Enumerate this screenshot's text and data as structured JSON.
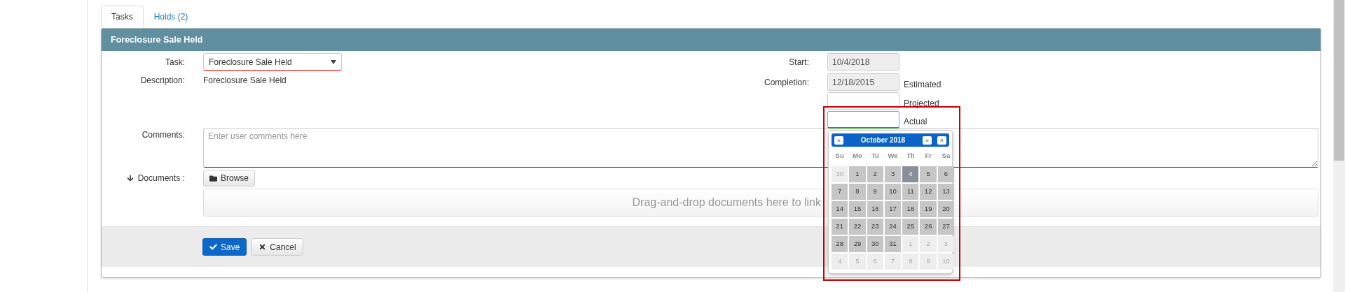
{
  "tabs": [
    {
      "label": "Tasks",
      "selected": true
    },
    {
      "label": "Holds (2)",
      "selected": false
    }
  ],
  "panel": {
    "title": "Foreclosure Sale Held",
    "task": {
      "label": "Task:",
      "value": "Foreclosure Sale Held"
    },
    "description": {
      "label": "Description:",
      "value": "Foreclosure Sale Held"
    },
    "start": {
      "label": "Start:",
      "value": "10/4/2018"
    },
    "completion": {
      "label": "Completion:",
      "value": "12/18/2015",
      "suffix": "Estimated"
    },
    "projected": {
      "suffix": "Projected"
    },
    "actual": {
      "suffix": "Actual"
    },
    "comments": {
      "label": "Comments:",
      "placeholder": "Enter user comments here"
    },
    "documents": {
      "label": "Documents :",
      "browse": "Browse",
      "dropzone": "Drag-and-drop documents here to link"
    },
    "buttons": [
      {
        "label": "Save",
        "kind": "primary"
      },
      {
        "label": "Cancel",
        "kind": "default"
      }
    ]
  },
  "datepicker": {
    "prev": "«",
    "title": "October 2018",
    "next": "»",
    "close": "×",
    "weekdays": [
      "Su",
      "Mo",
      "Tu",
      "We",
      "Th",
      "Fr",
      "Sa"
    ],
    "weeks": [
      [
        {
          "day": "30",
          "kind": "other",
          "selected": false
        },
        {
          "day": "1",
          "kind": "current",
          "selected": false
        },
        {
          "day": "2",
          "kind": "current",
          "selected": false
        },
        {
          "day": "3",
          "kind": "current",
          "selected": false
        },
        {
          "day": "4",
          "kind": "current",
          "selected": true
        },
        {
          "day": "5",
          "kind": "current",
          "selected": false
        },
        {
          "day": "6",
          "kind": "current",
          "selected": false
        }
      ],
      [
        {
          "day": "7",
          "kind": "current",
          "selected": false
        },
        {
          "day": "8",
          "kind": "current",
          "selected": false
        },
        {
          "day": "9",
          "kind": "current",
          "selected": false
        },
        {
          "day": "10",
          "kind": "current",
          "selected": false
        },
        {
          "day": "11",
          "kind": "current",
          "selected": false
        },
        {
          "day": "12",
          "kind": "current",
          "selected": false
        },
        {
          "day": "13",
          "kind": "current",
          "selected": false
        }
      ],
      [
        {
          "day": "14",
          "kind": "current",
          "selected": false
        },
        {
          "day": "15",
          "kind": "current",
          "selected": false
        },
        {
          "day": "16",
          "kind": "current",
          "selected": false
        },
        {
          "day": "17",
          "kind": "current",
          "selected": false
        },
        {
          "day": "18",
          "kind": "current",
          "selected": false
        },
        {
          "day": "19",
          "kind": "current",
          "selected": false
        },
        {
          "day": "20",
          "kind": "current",
          "selected": false
        }
      ],
      [
        {
          "day": "21",
          "kind": "current",
          "selected": false
        },
        {
          "day": "22",
          "kind": "current",
          "selected": false
        },
        {
          "day": "23",
          "kind": "current",
          "selected": false
        },
        {
          "day": "24",
          "kind": "current",
          "selected": false
        },
        {
          "day": "25",
          "kind": "current",
          "selected": false
        },
        {
          "day": "26",
          "kind": "current",
          "selected": false
        },
        {
          "day": "27",
          "kind": "current",
          "selected": false
        }
      ],
      [
        {
          "day": "28",
          "kind": "current",
          "selected": false
        },
        {
          "day": "29",
          "kind": "current",
          "selected": false
        },
        {
          "day": "30",
          "kind": "current",
          "selected": false
        },
        {
          "day": "31",
          "kind": "current",
          "selected": false
        },
        {
          "day": "1",
          "kind": "other",
          "selected": false
        },
        {
          "day": "2",
          "kind": "other",
          "selected": false
        },
        {
          "day": "3",
          "kind": "other",
          "selected": false
        }
      ],
      [
        {
          "day": "4",
          "kind": "other",
          "selected": false
        },
        {
          "day": "5",
          "kind": "other",
          "selected": false
        },
        {
          "day": "6",
          "kind": "other",
          "selected": false
        },
        {
          "day": "7",
          "kind": "other",
          "selected": false
        },
        {
          "day": "8",
          "kind": "other",
          "selected": false
        },
        {
          "day": "9",
          "kind": "other",
          "selected": false
        },
        {
          "day": "10",
          "kind": "other",
          "selected": false
        }
      ]
    ]
  }
}
